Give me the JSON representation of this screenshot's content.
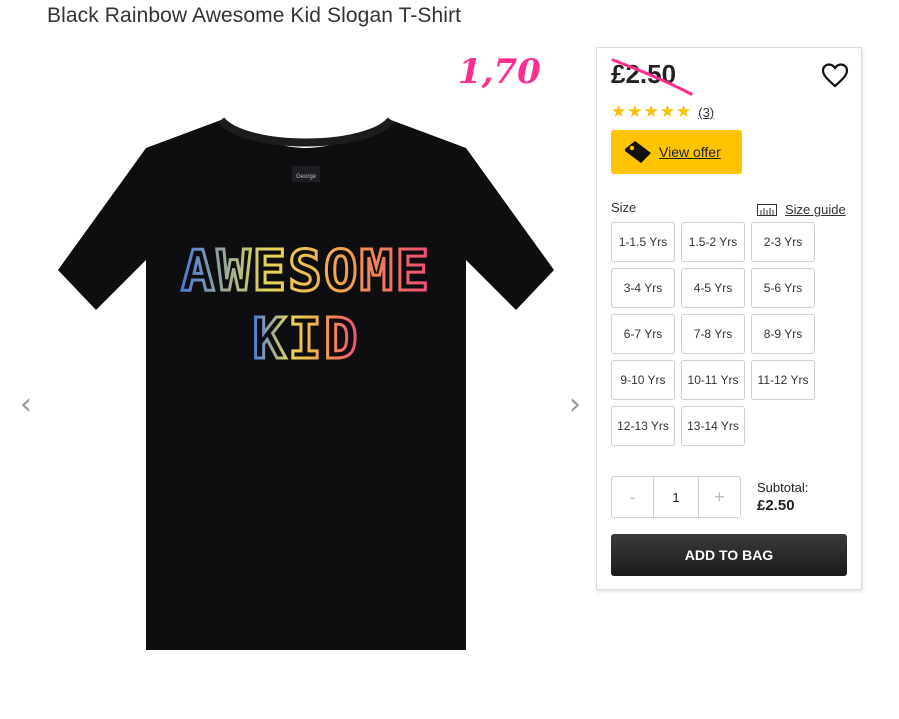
{
  "product": {
    "title": "Black Rainbow Awesome Kid Slogan T-Shirt",
    "image_alt": "Black t-shirt with AWESOME KID rainbow print",
    "shirt_text_line1": "AWESOME",
    "shirt_text_line2": "KID",
    "neck_label": "George"
  },
  "annotation": {
    "new_price": "1,70",
    "color": "#ff2d8e"
  },
  "gallery": {
    "prev_icon": "chevron-left-icon",
    "next_icon": "chevron-right-icon",
    "prev_glyph": "‹",
    "next_glyph": "›"
  },
  "pricing": {
    "old_price": "£2.50"
  },
  "rating": {
    "stars": 5,
    "count_label": "(3)"
  },
  "offer": {
    "label": "View offer",
    "icon": "price-tag-icon",
    "color": "#ffc400"
  },
  "sizes": {
    "label": "Size",
    "guide_label": "Size guide",
    "options": [
      "1-1.5 Yrs",
      "1.5-2 Yrs",
      "2-3 Yrs",
      "3-4 Yrs",
      "4-5 Yrs",
      "5-6 Yrs",
      "6-7 Yrs",
      "7-8 Yrs",
      "8-9 Yrs",
      "9-10 Yrs",
      "10-11 Yrs",
      "11-12 Yrs",
      "12-13 Yrs",
      "13-14 Yrs"
    ]
  },
  "quantity": {
    "minus": "-",
    "value": "1",
    "plus": "+"
  },
  "subtotal": {
    "label": "Subtotal:",
    "value": "£2.50"
  },
  "actions": {
    "add_to_bag": "ADD TO BAG"
  }
}
